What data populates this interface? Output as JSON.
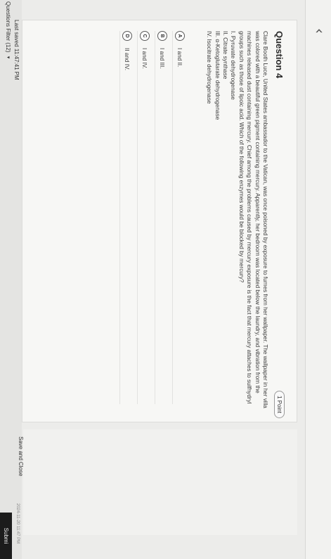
{
  "header": {
    "back_icon": "chevron-left-icon",
    "back_glyph": "‹"
  },
  "question": {
    "title": "Question 4",
    "points": "1 Point",
    "stem": "Clare Booth Luce, United States ambassador to the Vatican, was once poisoned by exposure to fumes from her wallpaper. The wallpaper in her villa was colored with a beautiful green pigment containing mercury. Apparently, her bedroom was located below the laundry, and vibration from the machines released dust containing mercury. Chief among the problems caused by mercury exposure is the fact that mercury attaches to sulfhydryl groups such as those of lipoic acid. Which of the following enzymes would be blocked by mercury?",
    "items": [
      "I. Pyruvate dehydrogenase",
      "II. Citrate synthase",
      "III. α-Ketoglutarate dehydrogenase",
      "IV. Isocitrate dehydrogenase"
    ],
    "options": [
      {
        "letter": "A",
        "text": "I and II."
      },
      {
        "letter": "B",
        "text": "I and III."
      },
      {
        "letter": "C",
        "text": "I and IV."
      },
      {
        "letter": "D",
        "text": "II and IV."
      }
    ]
  },
  "footer": {
    "last_saved": "Last saved 11:47:41 PM",
    "filter_label": "Questions Filter (12)",
    "filter_arrow": "▼",
    "save_close": "Save and Close",
    "submit": "Submi",
    "timestamp": "2024-11-20 11:47 PM"
  },
  "colors": {
    "submit_bg": "#1c1c1c",
    "page_bg": "#ececea"
  }
}
